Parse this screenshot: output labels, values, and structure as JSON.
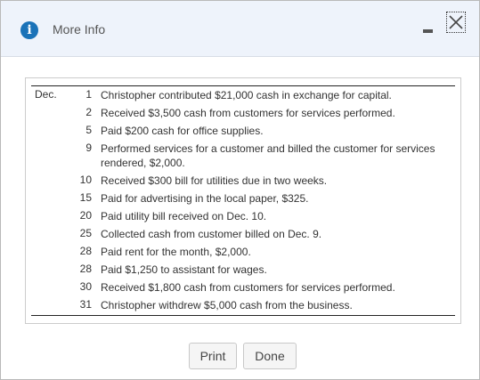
{
  "dialog": {
    "title": "More Info",
    "icons": {
      "info": "info-icon",
      "minimize": "minimize-icon",
      "close": "close-icon"
    }
  },
  "transactions": {
    "month": "Dec.",
    "items": [
      {
        "day": "1",
        "text": "Christopher contributed $21,000 cash in exchange for capital."
      },
      {
        "day": "2",
        "text": "Received $3,500 cash from customers for services performed."
      },
      {
        "day": "5",
        "text": "Paid $200 cash for office supplies."
      },
      {
        "day": "9",
        "text": "Performed services for a customer and billed the customer for services rendered, $2,000."
      },
      {
        "day": "10",
        "text": "Received $300 bill for utilities due in two weeks."
      },
      {
        "day": "15",
        "text": "Paid for advertising in the local paper, $325."
      },
      {
        "day": "20",
        "text": "Paid utility bill received on Dec. 10."
      },
      {
        "day": "25",
        "text": "Collected cash from customer billed on Dec. 9."
      },
      {
        "day": "28",
        "text": "Paid rent for the month, $2,000."
      },
      {
        "day": "28",
        "text": "Paid $1,250 to assistant for wages."
      },
      {
        "day": "30",
        "text": "Received $1,800 cash from customers for services performed."
      },
      {
        "day": "31",
        "text": "Christopher withdrew $5,000 cash from the business."
      }
    ]
  },
  "buttons": {
    "print": "Print",
    "done": "Done"
  }
}
